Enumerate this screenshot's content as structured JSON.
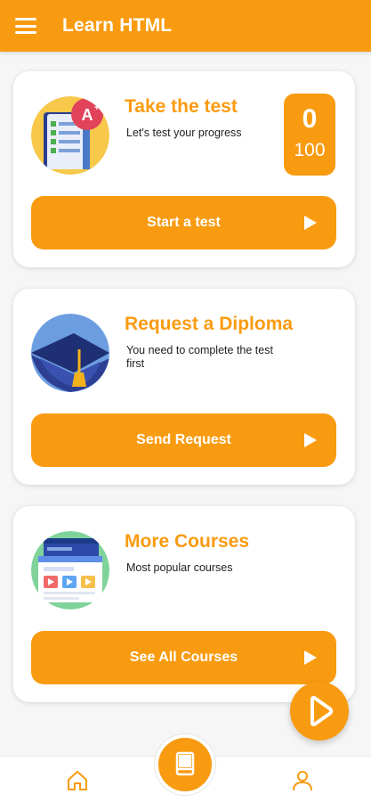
{
  "app": {
    "title": "Learn HTML",
    "accent_color": "#f99b10"
  },
  "header": {
    "menu_icon": "hamburger-menu-icon"
  },
  "cards": [
    {
      "title": "Take the test",
      "subtitle": "Let's test your progress",
      "button_label": "Start a test",
      "score": {
        "value": "0",
        "max": "100"
      },
      "illustration": "test-sheet-grade-a-icon"
    },
    {
      "title": "Request a Diploma",
      "subtitle": "You need to complete the test first",
      "button_label": "Send Request",
      "illustration": "graduation-cap-icon"
    },
    {
      "title": "More Courses",
      "subtitle": "Most popular courses",
      "button_label": "See All Courses",
      "illustration": "course-windows-icon"
    }
  ],
  "bottom_nav": {
    "items": [
      {
        "name": "home",
        "icon": "home-icon"
      },
      {
        "name": "courses",
        "icon": "book-icon"
      },
      {
        "name": "profile",
        "icon": "user-icon"
      }
    ]
  },
  "fab": {
    "icon": "play-icon"
  }
}
